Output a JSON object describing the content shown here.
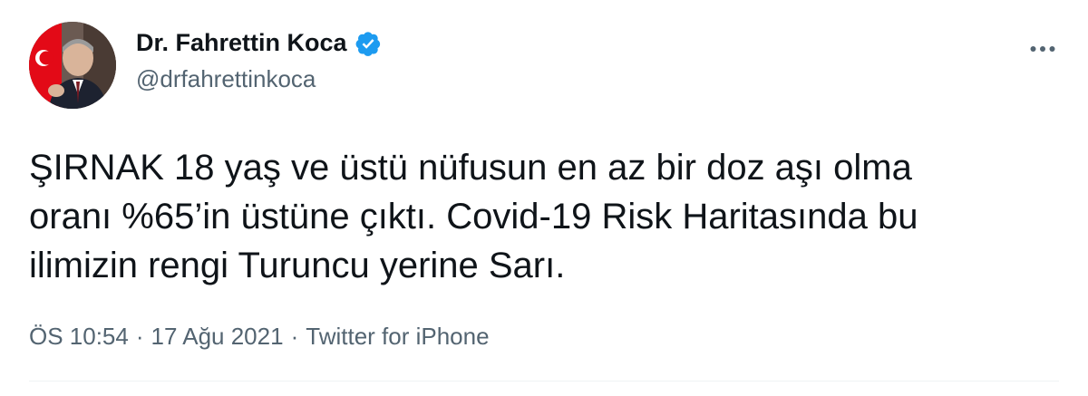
{
  "author": {
    "display_name": "Dr. Fahrettin Koca",
    "handle": "@drfahrettinkoca",
    "verified": true
  },
  "tweet": {
    "text": "ŞIRNAK 18 yaş ve üstü nüfusun en az bir doz aşı olma\noranı %65’in üstüne çıktı. Covid-19 Risk Haritasında bu\nilimizin rengi Turuncu yerine Sarı."
  },
  "meta": {
    "time": "ÖS 10:54",
    "separator": "·",
    "date": "17 Ağu 2021",
    "source": "Twitter for iPhone"
  },
  "icons": {
    "verified": "verified-badge-icon",
    "more": "more-options-icon"
  },
  "colors": {
    "text_primary": "#0f1419",
    "text_secondary": "#536471",
    "verified_blue": "#1d9bf0",
    "flag_red": "#e30a17"
  }
}
